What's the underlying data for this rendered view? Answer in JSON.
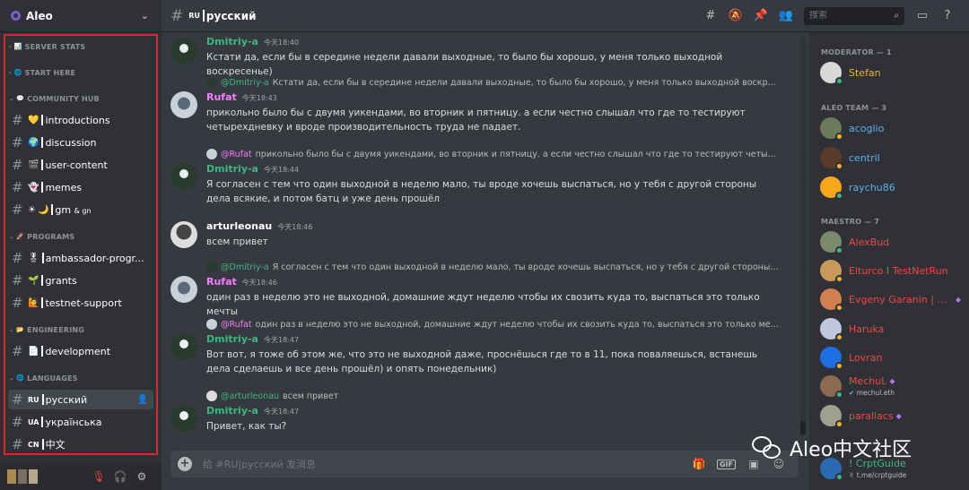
{
  "server": {
    "name": "Aleo",
    "chevron_icon": "chevron-down-icon"
  },
  "sidebar": {
    "categories": [
      {
        "name": "SERVER STATS",
        "icon": "chart-icon"
      },
      {
        "name": "START HERE",
        "icon": "globe-icon"
      },
      {
        "name": "COMMUNITY HUB",
        "icon": "speech-icon"
      },
      {
        "name": "PROGRAMS",
        "icon": "rocket-icon"
      },
      {
        "name": "ENGINEERING",
        "icon": "folder-icon"
      },
      {
        "name": "LANGUAGES",
        "icon": "globe-icon"
      }
    ],
    "channels": {
      "introductions": "introductions",
      "discussion": "discussion",
      "user_content": "user-content",
      "memes": "memes",
      "gm_gn": "gm",
      "gm_gn_amp": "& gn",
      "ambassador": "ambassador-progr...",
      "grants": "grants",
      "testnet": "testnet-support",
      "development": "development",
      "ru_flag": "RU",
      "ru": "русский",
      "ua_flag": "UA",
      "ua": "українська",
      "cn_flag": "CN",
      "cn": "中文"
    }
  },
  "topbar": {
    "flag": "RU",
    "title": "русский",
    "search_placeholder": "搜索",
    "icons": [
      "threads-icon",
      "mute-bell-icon",
      "pin-icon",
      "members-icon",
      "inbox-icon",
      "help-icon"
    ]
  },
  "messages": [
    {
      "author": "Dmitriy-a",
      "time": "今天18:40",
      "text": "Кстати да, если бы в середине недели давали выходные, то было бы хорошо, у меня только выходной воскресенье)"
    },
    {
      "reply_author": "@Dmitriy-a",
      "reply_text": "Кстати да, если бы в середине недели давали выходные, то было бы хорошо, у меня только выходной воскресенье)",
      "author": "Rufat",
      "time": "今天18:43",
      "text": "прикольно было бы с двумя уикендами, во вторник и пятницу. а если честно слышал что где то тестируют четырехдневку и вроде производительность труда не падает."
    },
    {
      "reply_author": "@Rufat",
      "reply_text": "прикольно было бы с двумя уикендами, во вторник и пятницу. а если честно слышал что где то тестируют четырехдневку и вр...",
      "author": "Dmitriy-a",
      "time": "今天18:44",
      "text": "Я согласен с тем что один выходной в неделю мало, ты вроде хочешь выспаться, но у тебя с другой стороны дела всякие, и потом батц и уже день прошёл"
    },
    {
      "author": "arturleonau",
      "time": "今天18:46",
      "text": "всем привет"
    },
    {
      "reply_author": "@Dmitriy-a",
      "reply_text": "Я согласен с тем что один выходной в неделю мало, ты вроде хочешь выспаться, но у тебя с другой стороны дела всякие, ...",
      "author": "Rufat",
      "time": "今天18:46",
      "text": "один раз в неделю это не выходной, домашние ждут неделю чтобы их свозить куда то, выспаться это только мечты"
    },
    {
      "reply_author": "@Rufat",
      "reply_text": "один раз в неделю это не выходной, домашние ждут неделю чтобы их свозить куда то, выспаться это только мечты",
      "author": "Dmitriy-a",
      "time": "今天18:47",
      "text": "Вот вот, я тоже об этом же, что это не выходной даже, проснёшься где то в 11, пока поваляешься, встанешь дела сделаешь и все день прошёл) и опять понедельник)"
    },
    {
      "reply_author": "@arturleonau",
      "reply_text": "всем привет",
      "author": "Dmitriy-a",
      "time": "今天18:47",
      "text": "Привет, как ты?"
    }
  ],
  "composer": {
    "placeholder": "给 #RU|русский 发消息",
    "icons": [
      "gift-icon",
      "gif-icon",
      "sticker-icon",
      "emoji-icon"
    ],
    "gif_label": "GIF"
  },
  "members": {
    "roles": [
      {
        "name": "MODERATOR — 1"
      },
      {
        "name": "ALEO TEAM — 3"
      },
      {
        "name": "MAESTRO — 7"
      }
    ],
    "list": [
      {
        "name": "Stefan",
        "color": "#f0b232"
      },
      {
        "name": "acoglio",
        "color": "#5ab0f0"
      },
      {
        "name": "centril",
        "color": "#5ab0f0"
      },
      {
        "name": "raychu86",
        "color": "#5ab0f0"
      },
      {
        "name": "AlexBud",
        "color": "#f04747"
      },
      {
        "name": "Elturco I TestNetRun",
        "color": "#f04747"
      },
      {
        "name": "Evgeny Garanin | No...",
        "color": "#f04747"
      },
      {
        "name": "Haruka",
        "color": "#f04747"
      },
      {
        "name": "Lovran",
        "color": "#f04747"
      },
      {
        "name": "MechuL",
        "color": "#f04747",
        "sub": "mechul.eth"
      },
      {
        "name": "parallacs",
        "color": "#f04747"
      },
      {
        "name": "! CrptGuide",
        "color": "#43b581",
        "sub": "t.me/crptguide"
      }
    ]
  },
  "watermark": {
    "text": "Aleo中文社区"
  }
}
